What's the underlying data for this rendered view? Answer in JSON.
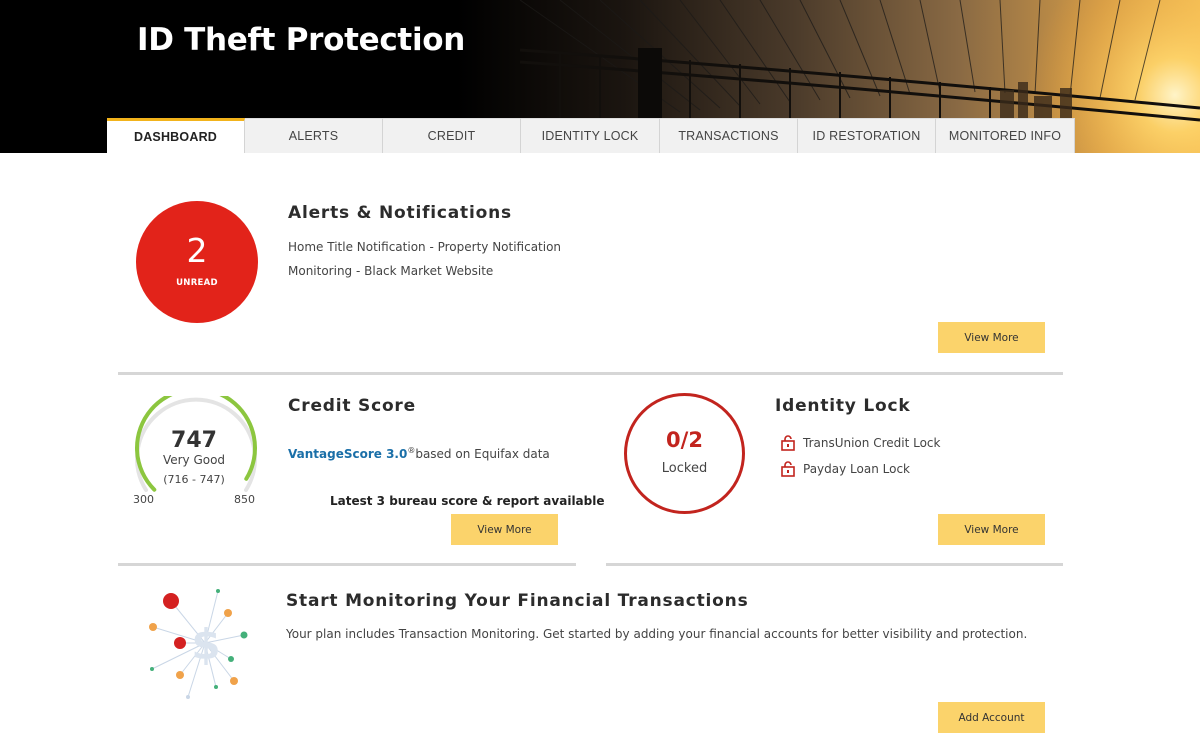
{
  "header": {
    "title": "ID Theft Protection"
  },
  "tabs": [
    {
      "label": "DASHBOARD",
      "active": true
    },
    {
      "label": "ALERTS",
      "active": false
    },
    {
      "label": "CREDIT",
      "active": false
    },
    {
      "label": "IDENTITY LOCK",
      "active": false
    },
    {
      "label": "TRANSACTIONS",
      "active": false
    },
    {
      "label": "ID RESTORATION",
      "active": false
    },
    {
      "label": "MONITORED INFO",
      "active": false
    }
  ],
  "alerts": {
    "title": "Alerts & Notifications",
    "unread_count": "2",
    "unread_label": "UNREAD",
    "items": [
      "Home Title Notification - Property Notification",
      "Monitoring - Black Market Website"
    ],
    "button": "View More"
  },
  "credit": {
    "title": "Credit Score",
    "score": "747",
    "rating": "Very Good",
    "rating_range": "(716 - 747)",
    "gauge_min": "300",
    "gauge_max": "850",
    "gauge_fill_fraction": 0.95,
    "model_name": "VantageScore 3.0",
    "model_mark": "®",
    "model_source": "based on Equifax data",
    "bureau_note": "Latest 3 bureau score & report available",
    "button": "View More"
  },
  "identity_lock": {
    "title": "Identity Lock",
    "count": "0/2",
    "status": "Locked",
    "items": [
      "TransUnion Credit Lock",
      "Payday Loan Lock"
    ],
    "button": "View More"
  },
  "transactions": {
    "title": "Start Monitoring Your Financial Transactions",
    "description": "Your plan includes Transaction Monitoring. Get started by adding your financial accounts for better visibility and protection.",
    "button": "Add Account"
  },
  "colors": {
    "accent": "#fbd36b",
    "tab_active_border": "#f2b31b",
    "alert_red": "#e2231a",
    "lock_red": "#c2241e",
    "gauge_green": "#8cc63f",
    "link_blue": "#1a6fa8"
  }
}
